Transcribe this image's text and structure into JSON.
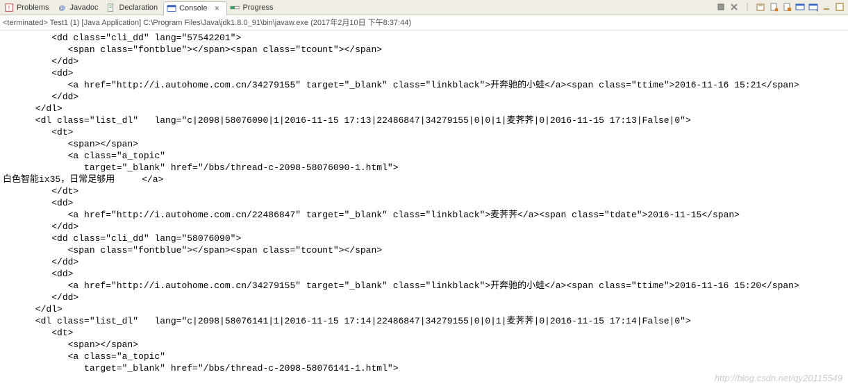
{
  "tabs": [
    {
      "label": "Problems",
      "icon": "problems"
    },
    {
      "label": "Javadoc",
      "icon": "javadoc"
    },
    {
      "label": "Declaration",
      "icon": "declaration"
    },
    {
      "label": "Console",
      "icon": "console",
      "active": true,
      "closable": true
    },
    {
      "label": "Progress",
      "icon": "progress"
    }
  ],
  "terminated": "<terminated> Test1 (1) [Java Application] C:\\Program Files\\Java\\jdk1.8.0_91\\bin\\javaw.exe (2017年2月10日 下午8:37:44)",
  "console_lines": [
    "         <dd class=\"cli_dd\" lang=\"57542201\">",
    "            <span class=\"fontblue\"></span><span class=\"tcount\"></span>",
    "         </dd>",
    "         <dd>",
    "            <a href=\"http://i.autohome.com.cn/34279155\" target=\"_blank\" class=\"linkblack\">开奔驰的小蛙</a><span class=\"ttime\">2016-11-16 15:21</span>",
    "         </dd>",
    "      </dl>",
    "      <dl class=\"list_dl\"   lang=\"c|2098|58076090|1|2016-11-15 17:13|22486847|34279155|0|0|1|麦荠荠|0|2016-11-15 17:13|False|0\">",
    "         <dt>",
    "            <span></span>",
    "            <a class=\"a_topic\"",
    "               target=\"_blank\" href=\"/bbs/thread-c-2098-58076090-1.html\">",
    "白色智能ix35，日常足够用     </a>",
    "         </dt>",
    "         <dd>",
    "            <a href=\"http://i.autohome.com.cn/22486847\" target=\"_blank\" class=\"linkblack\">麦荠荠</a><span class=\"tdate\">2016-11-15</span>",
    "         </dd>",
    "         <dd class=\"cli_dd\" lang=\"58076090\">",
    "            <span class=\"fontblue\"></span><span class=\"tcount\"></span>",
    "         </dd>",
    "         <dd>",
    "            <a href=\"http://i.autohome.com.cn/34279155\" target=\"_blank\" class=\"linkblack\">开奔驰的小蛙</a><span class=\"ttime\">2016-11-16 15:20</span>",
    "         </dd>",
    "      </dl>",
    "      <dl class=\"list_dl\"   lang=\"c|2098|58076141|1|2016-11-15 17:14|22486847|34279155|0|0|1|麦荠荠|0|2016-11-15 17:14|False|0\">",
    "         <dt>",
    "            <span></span>",
    "            <a class=\"a_topic\"",
    "               target=\"_blank\" href=\"/bbs/thread-c-2098-58076141-1.html\">"
  ],
  "watermark": "http://blog.csdn.net/qy20115549",
  "icons": {
    "problems_color": "#c03030",
    "javadoc_color": "#3060c0",
    "declaration_color": "#30a030",
    "console_color": "#3060c0",
    "progress_color": "#30a060"
  },
  "toolbar": [
    "remove-launch",
    "remove-all",
    "divider",
    "scroll-lock",
    "clear-console",
    "pin-console",
    "display-selected",
    "open-console",
    "minimize",
    "maximize"
  ]
}
